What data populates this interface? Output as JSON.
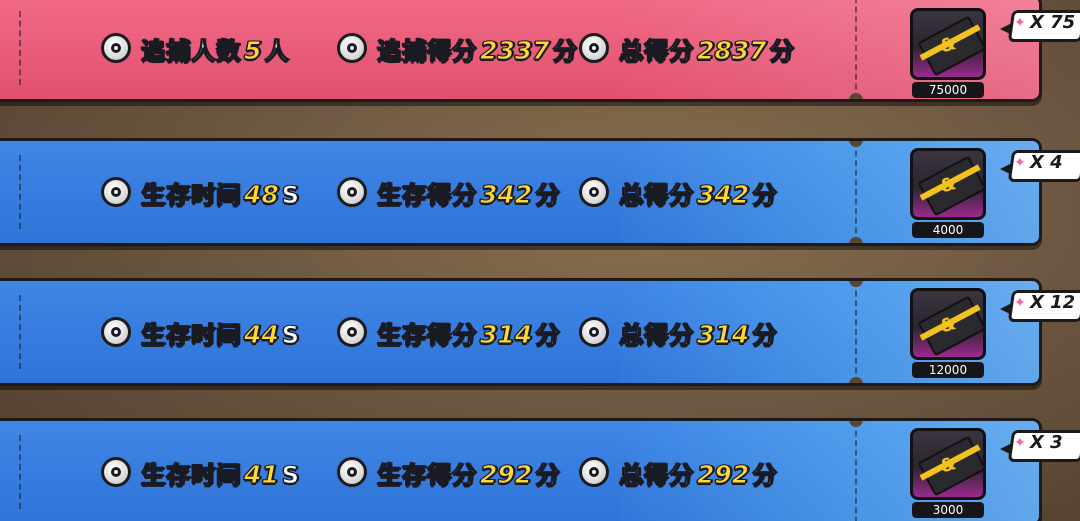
{
  "rows": [
    {
      "theme": "red",
      "stat1": {
        "label": "追捕人数",
        "value": "5",
        "unit": "人"
      },
      "stat2": {
        "label": "追捕得分",
        "value": "2337",
        "unit": "分"
      },
      "stat3": {
        "label": "总得分",
        "value": "2837",
        "unit": "分"
      },
      "reward": {
        "amount": "75000",
        "multiplier": "X 75",
        "icon": "ticket-icon"
      }
    },
    {
      "theme": "blue",
      "stat1": {
        "label": "生存时间",
        "value": "48",
        "unit": "S"
      },
      "stat2": {
        "label": "生存得分",
        "value": "342",
        "unit": "分"
      },
      "stat3": {
        "label": "总得分",
        "value": "342",
        "unit": "分"
      },
      "reward": {
        "amount": "4000",
        "multiplier": "X 4",
        "icon": "ticket-icon"
      }
    },
    {
      "theme": "blue",
      "stat1": {
        "label": "生存时间",
        "value": "44",
        "unit": "S"
      },
      "stat2": {
        "label": "生存得分",
        "value": "314",
        "unit": "分"
      },
      "stat3": {
        "label": "总得分",
        "value": "314",
        "unit": "分"
      },
      "reward": {
        "amount": "12000",
        "multiplier": "X 12",
        "icon": "ticket-icon"
      }
    },
    {
      "theme": "blue",
      "stat1": {
        "label": "生存时间",
        "value": "41",
        "unit": "S"
      },
      "stat2": {
        "label": "生存得分",
        "value": "292",
        "unit": "分"
      },
      "stat3": {
        "label": "总得分",
        "value": "292",
        "unit": "分"
      },
      "reward": {
        "amount": "3000",
        "multiplier": "X 3",
        "icon": "ticket-icon"
      }
    }
  ],
  "colors": {
    "red_row": "#e2506f",
    "blue_row": "#2f74d8",
    "number": "#ffd836"
  }
}
